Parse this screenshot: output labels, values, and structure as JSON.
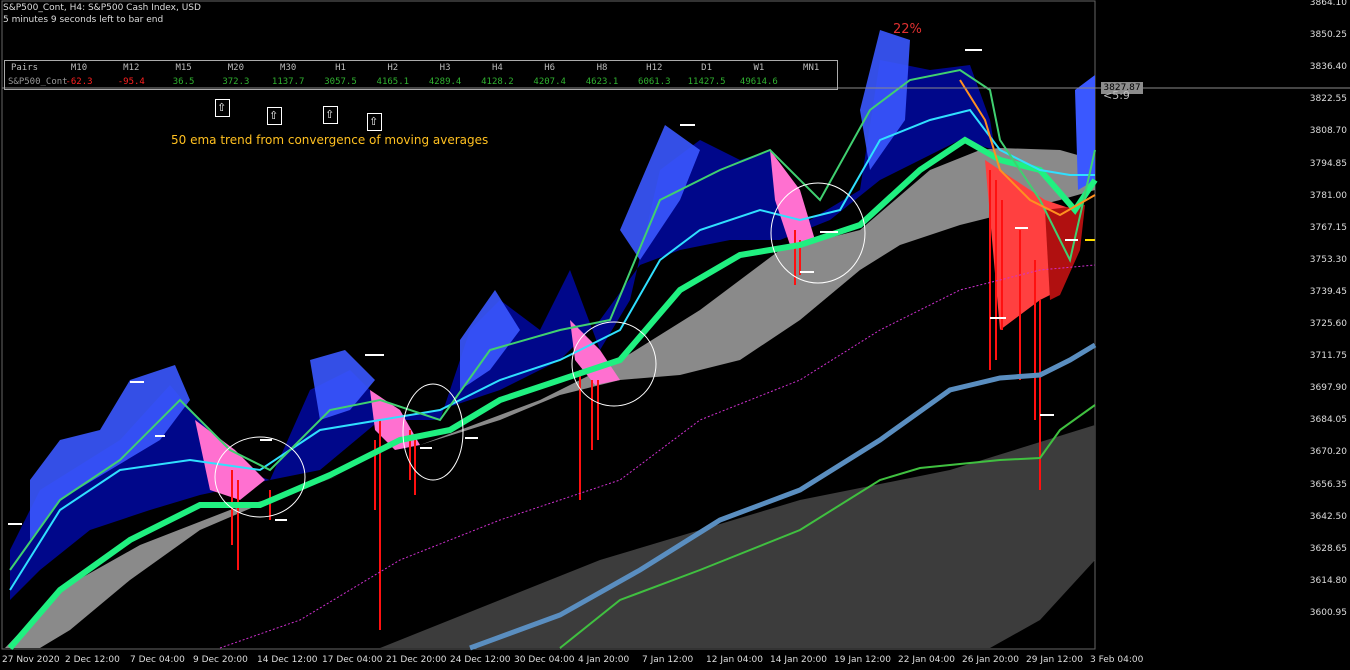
{
  "header": {
    "line1": "S&P500_Cont, H4:  S&P500 Cash Index, USD",
    "line2": "5 minutes 9 seconds left to bar end"
  },
  "annotation": {
    "percent": "22%",
    "note": "50 ema trend from convergence of moving averages"
  },
  "panel": {
    "pairs_header": "Pairs",
    "pair_name": "S&P500_Cont",
    "timeframes": [
      "M10",
      "M12",
      "M15",
      "M20",
      "M30",
      "H1",
      "H2",
      "H3",
      "H4",
      "H6",
      "H8",
      "H12",
      "D1",
      "W1",
      "MN1"
    ],
    "values": [
      "-62.3",
      "-95.4",
      "36.5",
      "372.3",
      "1137.7",
      "3057.5",
      "4165.1",
      "4289.4",
      "4128.2",
      "4207.4",
      "4623.1",
      "6061.3",
      "11427.5",
      "49614.6",
      ""
    ]
  },
  "price_axis": {
    "ticks": [
      "3864.10",
      "3850.25",
      "3836.40",
      "3822.55",
      "3808.70",
      "3794.85",
      "3781.00",
      "3767.15",
      "3753.30",
      "3739.45",
      "3725.60",
      "3711.75",
      "3697.90",
      "3684.05",
      "3670.20",
      "3656.35",
      "3642.50",
      "3628.65",
      "3614.80",
      "3600.95"
    ],
    "current_price": "3827.87",
    "timer": "<5:9"
  },
  "time_axis": {
    "ticks": [
      "27 Nov 2020",
      "2 Dec 12:00",
      "7 Dec 04:00",
      "9 Dec 20:00",
      "14 Dec 12:00",
      "17 Dec 04:00",
      "21 Dec 20:00",
      "24 Dec 12:00",
      "30 Dec 04:00",
      "4 Jan 20:00",
      "7 Jan 12:00",
      "12 Jan 04:00",
      "14 Jan 20:00",
      "19 Jan 12:00",
      "22 Jan 04:00",
      "26 Jan 20:00",
      "29 Jan 12:00",
      "3 Feb 04:00"
    ]
  },
  "colors": {
    "background": "#000000",
    "blue_fill": "#000a8c",
    "light_blue": "#3a6aff",
    "cyan": "#30e0ff",
    "green_line": "#20f080",
    "grey_band": "#808080",
    "pink": "#ff70d0",
    "red": "#ff1010",
    "steel_blue": "#5588bb",
    "orange": "#ff9020",
    "magenta_dots": "#d030d0"
  }
}
